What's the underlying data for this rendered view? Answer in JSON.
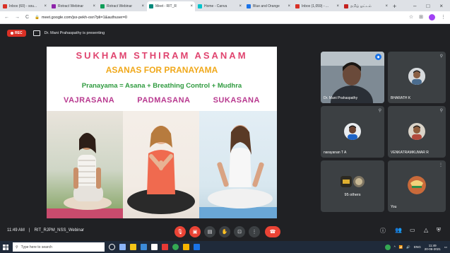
{
  "browser": {
    "tabs": [
      {
        "title": "Inbox (60) - sou...",
        "color": "#d93025",
        "active": false
      },
      {
        "title": "Rotract Webinar",
        "color": "#8e24aa",
        "active": false
      },
      {
        "title": "Rotract Webinar",
        "color": "#0f9d58",
        "active": false
      },
      {
        "title": "Meet - RIT_R",
        "color": "#00897b",
        "active": true
      },
      {
        "title": "Home - Canva",
        "color": "#00c4cc",
        "active": false
      },
      {
        "title": "Blue and Orange",
        "color": "#1a73e8",
        "active": false
      },
      {
        "title": "Inbox (1,059) - ...",
        "color": "#d93025",
        "active": false
      },
      {
        "title": "தமிழ் ஓட்டம்",
        "color": "#c5221f",
        "active": false
      }
    ],
    "new_tab": "+",
    "win_controls": [
      "–",
      "□",
      "×"
    ],
    "url": "meet.google.com/jsx-pekh-osn?pli=1&authuser=0",
    "nav": [
      "←",
      "→",
      "C"
    ]
  },
  "meet": {
    "rec_label": "REC",
    "presenting_text": "Dr. Mani Prahaspathy is presenting",
    "meeting_time": "11:49 AM",
    "meeting_separator": "|",
    "meeting_name": "RIT_RJPM_NSS_Webinar"
  },
  "slide": {
    "title": "SUKHAM  STHIRAM  ASANAM",
    "subtitle": "ASANAS FOR PRANAYAMA",
    "formula": "Pranayama = Asana + Breathing Control + Mudhra",
    "asanas": [
      "VAJRASANA",
      "PADMASANA",
      "SUKASANA"
    ]
  },
  "participants": [
    {
      "name": "Dr. Mani Prahaspathy"
    },
    {
      "name": "BHARATH K"
    },
    {
      "name": "narayanan T A"
    },
    {
      "name": "VENKATRAMKUMAR R"
    },
    {
      "name": "95 others"
    },
    {
      "name": "You"
    }
  ],
  "taskbar": {
    "search_placeholder": "Type here to search",
    "time": "11:49",
    "date": "20-06-2021",
    "lang": "ENG"
  }
}
